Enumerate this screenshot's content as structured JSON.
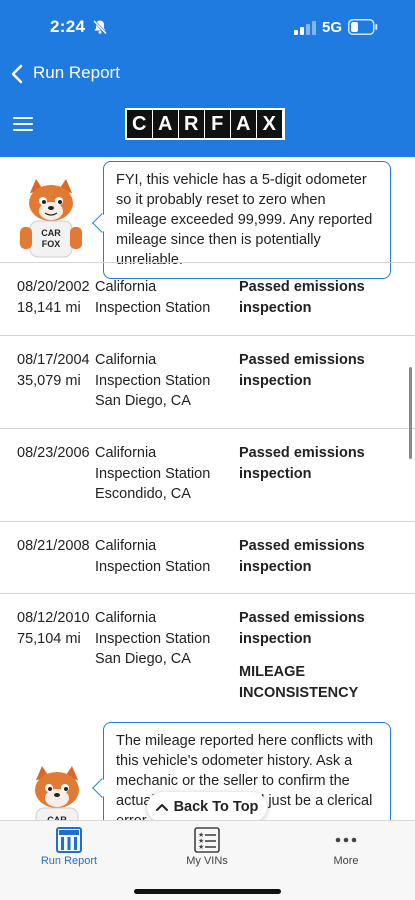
{
  "status_bar": {
    "time": "2:24",
    "network": "5G"
  },
  "nav": {
    "back_label": "Run Report"
  },
  "logo": {
    "letters": [
      "C",
      "A",
      "R",
      "F",
      "A",
      "X"
    ]
  },
  "tips": [
    {
      "text": "FYI, this vehicle has a 5-digit odometer so it probably reset to zero when mileage exceeded 99,999. Any reported mileage since then is potentially unreliable."
    },
    {
      "text": "The mileage reported here conflicts with this vehicle's odometer history. Ask a mechanic or the seller to confirm the actual mileage. It could just be a clerical error."
    }
  ],
  "fox_shirt": [
    "CAR",
    "FOX"
  ],
  "records": [
    {
      "date": "08/20/2002",
      "mileage": "18,141 mi",
      "source": [
        "California",
        "Inspection Station"
      ],
      "comments": "Passed emissions inspection",
      "flag": ""
    },
    {
      "date": "08/17/2004",
      "mileage": "35,079 mi",
      "source": [
        "California",
        "Inspection Station",
        "San Diego, CA"
      ],
      "comments": "Passed emissions inspection",
      "flag": ""
    },
    {
      "date": "08/23/2006",
      "mileage": "",
      "source": [
        "California",
        "Inspection Station",
        "Escondido, CA"
      ],
      "comments": "Passed emissions inspection",
      "flag": ""
    },
    {
      "date": "08/21/2008",
      "mileage": "",
      "source": [
        "California",
        "Inspection Station"
      ],
      "comments": "Passed emissions inspection",
      "flag": ""
    },
    {
      "date": "08/12/2010",
      "mileage": "75,104 mi",
      "source": [
        "California",
        "Inspection Station",
        "San Diego, CA"
      ],
      "comments": "Passed emissions inspection",
      "flag": "MILEAGE INCONSISTENCY"
    }
  ],
  "back_to_top": {
    "label": "Back To Top"
  },
  "tabs": [
    {
      "label": "Run Report",
      "icon": "run-report-icon",
      "active": true
    },
    {
      "label": "My VINs",
      "icon": "list-icon",
      "active": false
    },
    {
      "label": "More",
      "icon": "more-dots-icon",
      "active": false
    }
  ],
  "colors": {
    "brand_blue": "#1f7be0",
    "active_tab": "#1f6fcc"
  }
}
